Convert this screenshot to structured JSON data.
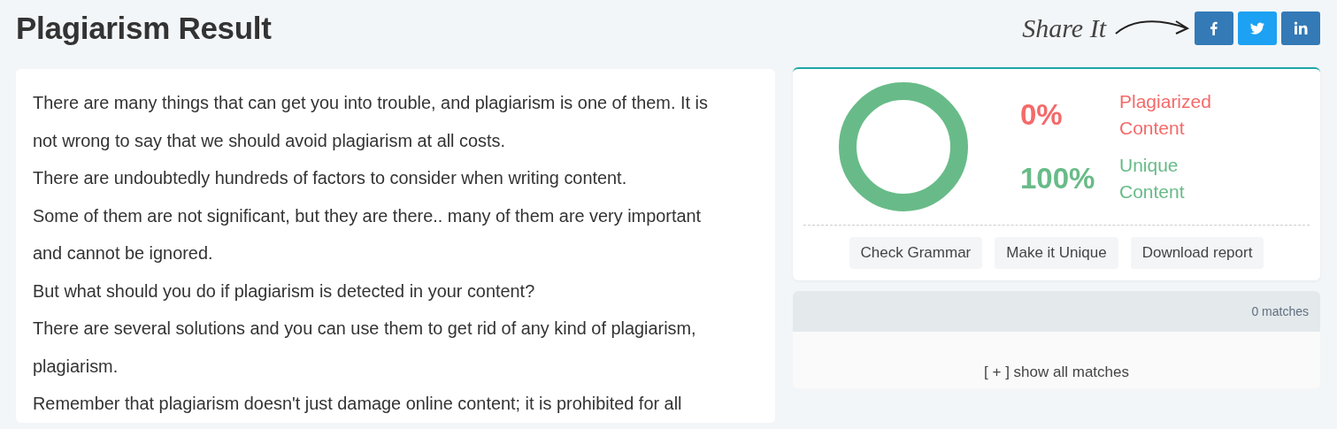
{
  "page": {
    "title": "Plagiarism Result",
    "share_label": "Share It"
  },
  "share_buttons": [
    {
      "kind": "facebook",
      "color": "#337ab7"
    },
    {
      "kind": "twitter",
      "color": "#1da1f2"
    },
    {
      "kind": "linkedin",
      "color": "#337ab7"
    }
  ],
  "content": [
    "There are many things that can get you into trouble, and plagiarism is one of them. It is not wrong to say that we should avoid plagiarism at all costs.",
    "There are undoubtedly hundreds of factors to consider when writing content.",
    "Some of them are not significant, but they are there.. many of them are very important and cannot be ignored.",
    "But what should you do if plagiarism is detected in your content?",
    "There are several solutions and you can use them to get rid of any kind of plagiarism, plagiarism.",
    "Remember that plagiarism doesn't just damage online content; it is prohibited for all"
  ],
  "results": [
    {
      "percent": "0%",
      "label": "Plagiarized Content",
      "color": "#f46a6a"
    },
    {
      "percent": "100%",
      "label": "Unique Content",
      "color": "#68bb88"
    }
  ],
  "actions": [
    "Check Grammar",
    "Make it Unique",
    "Download report"
  ],
  "matches": {
    "count": "0 matches",
    "toggle": "[ + ] show all matches"
  }
}
